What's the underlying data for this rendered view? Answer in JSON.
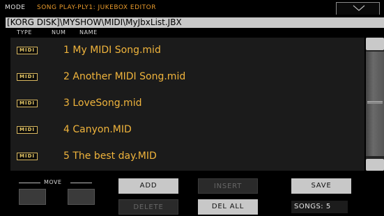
{
  "title_bar": {
    "mode_label": "MODE",
    "mode_title": "SONG PLAY-PLY1: JUKEBOX EDITOR",
    "menu_icon": "chevron-down-icon"
  },
  "path": "[KORG DISK]\\MYSHOW\\MIDI\\MyJbxList.JBX",
  "columns": {
    "type": "TYPE",
    "num": "NUM",
    "name": "NAME"
  },
  "rows": [
    {
      "type": "MIDI",
      "num": "1",
      "name": "My MIDI Song.mid"
    },
    {
      "type": "MIDI",
      "num": "2",
      "name": "Another MIDI Song.mid"
    },
    {
      "type": "MIDI",
      "num": "3",
      "name": "LoveSong.mid"
    },
    {
      "type": "MIDI",
      "num": "4",
      "name": "Canyon.MID"
    },
    {
      "type": "MIDI",
      "num": "5",
      "name": "The best day.MID"
    }
  ],
  "move": {
    "label": "MOVE"
  },
  "buttons": {
    "add": "ADD",
    "insert": "INSERT",
    "save": "SAVE",
    "delete": "DELETE",
    "del_all": "DEL ALL"
  },
  "songs_count": "SONGS: 5",
  "colors": {
    "accent_orange": "#e89a2c",
    "song_text": "#f0b43c",
    "badge_gold": "#e6c866"
  }
}
